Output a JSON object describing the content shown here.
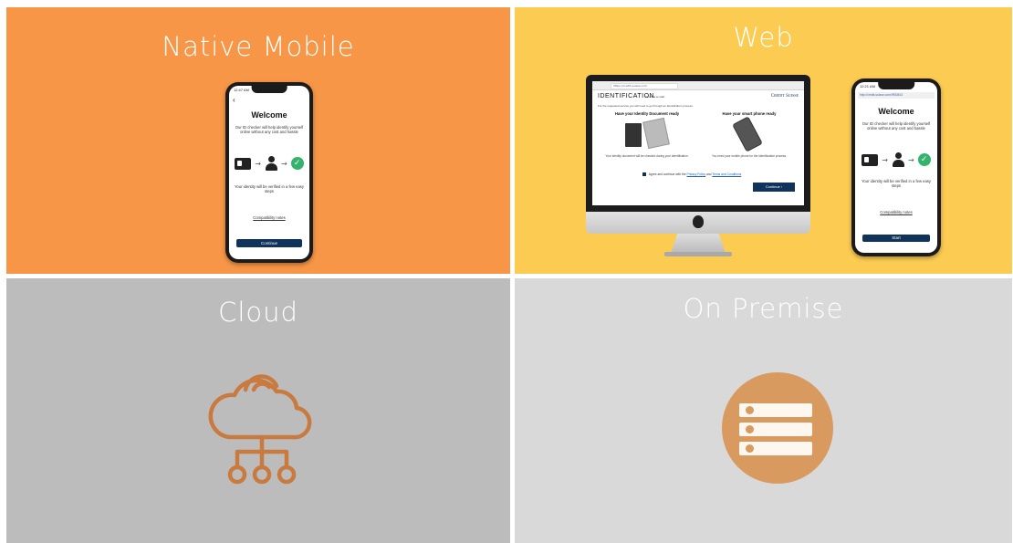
{
  "panels": {
    "native_mobile": {
      "title": "Native Mobile",
      "phone": {
        "status_time": "12:47 AM",
        "welcome": "Welcome",
        "description": "Our ID checker will help identify yourself online without any cost and hassle",
        "verify_text": "Your identity will be verified in a few easy steps",
        "compat_link": "Compatibility notes",
        "button": "Continue"
      }
    },
    "web": {
      "title": "Web",
      "desktop": {
        "url": "https://credit-suisse.com",
        "heading": "IDENTIFICATION",
        "subheading": "continue to start",
        "brand": "Credit Suisse",
        "intro": "For the requested service you will need to go through an identification process.",
        "col1_title": "Have your Identity Document ready",
        "col1_desc": "Your identity document will be checked during your identification.",
        "col2_title": "Have your smart phone ready",
        "col2_desc": "You need your mobile phone for the identification process.",
        "agree_prefix": "Agree and continue with the",
        "privacy_link": "Privacy Policy",
        "and_text": "and",
        "terms_link": "Terms and Conditions",
        "button": "Continue"
      },
      "phone": {
        "status_time": "12:21 AM",
        "url": "http://credit-suisse.com/IRID843",
        "welcome": "Welcome",
        "description": "Our ID checker will help identify yourself online without any cost and hassle",
        "verify_text": "Your identity will be verified in a few easy steps",
        "compat_link": "Compatibility notes",
        "button": "Start"
      }
    },
    "cloud": {
      "title": "Cloud",
      "icon": "cloud-network-icon",
      "icon_color": "#c97a3f"
    },
    "on_premise": {
      "title": "On Premise",
      "icon": "server-stack-icon",
      "icon_color": "#d99a60"
    }
  },
  "colors": {
    "native_mobile_bg": "#f79646",
    "web_bg": "#fccb52",
    "cloud_bg": "#bcbcbc",
    "on_premise_bg": "#d9d9d9",
    "brand_navy": "#10335b",
    "check_green": "#33b36b"
  }
}
